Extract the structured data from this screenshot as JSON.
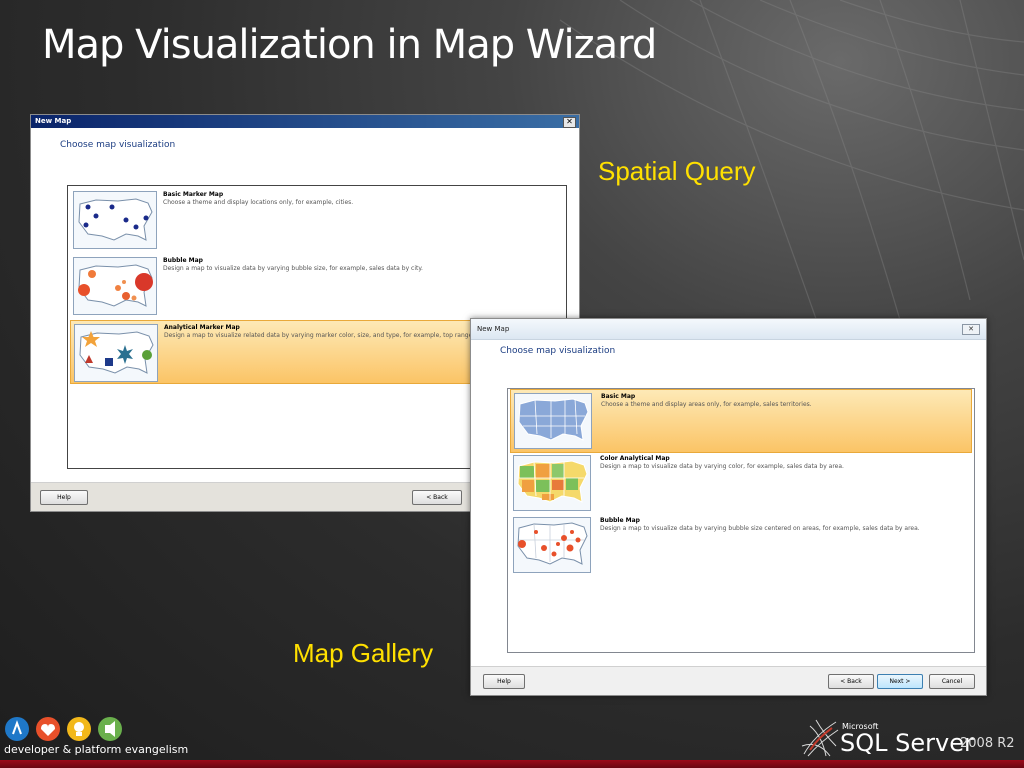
{
  "slide": {
    "title": "Map Visualization in Map Wizard",
    "callout_spatial": "Spatial Query",
    "callout_gallery": "Map Gallery",
    "footer_text_a": "developer & platform",
    "footer_text_b": " evangelism",
    "ms_label": "Microsoft",
    "product_name": "SQL Server",
    "product_version": "2008 R2",
    "accent_color": "#ffe000"
  },
  "dialog_spatial": {
    "title": "New Map",
    "heading": "Choose map visualization",
    "items": [
      {
        "name": "Basic Marker Map",
        "description": "Choose a theme and display locations only, for example, cities.",
        "icon": "basic-marker-map-icon",
        "selected": false
      },
      {
        "name": "Bubble Map",
        "description": "Design a map to visualize data by varying bubble size, for example, sales data by city.",
        "icon": "bubble-map-icon",
        "selected": false
      },
      {
        "name": "Analytical Marker Map",
        "description": "Design a map to visualize related data by varying marker color, size, and type, for example, top range, and discount strategy.",
        "icon": "analytical-marker-map-icon",
        "selected": true
      }
    ],
    "buttons": {
      "help": "Help",
      "back": "< Back"
    }
  },
  "dialog_gallery": {
    "title": "New Map",
    "heading": "Choose map visualization",
    "items": [
      {
        "name": "Basic Map",
        "description": "Choose a theme and display areas only, for example, sales territories.",
        "icon": "basic-map-icon",
        "selected": true
      },
      {
        "name": "Color Analytical Map",
        "description": "Design a map to visualize data by varying color, for example, sales data by area.",
        "icon": "color-analytical-map-icon",
        "selected": false
      },
      {
        "name": "Bubble Map",
        "description": "Design a map to visualize data by varying bubble size centered on areas, for example, sales data by area.",
        "icon": "bubble-area-map-icon",
        "selected": false
      }
    ],
    "buttons": {
      "help": "Help",
      "back": "< Back",
      "next": "Next >",
      "cancel": "Cancel"
    }
  }
}
